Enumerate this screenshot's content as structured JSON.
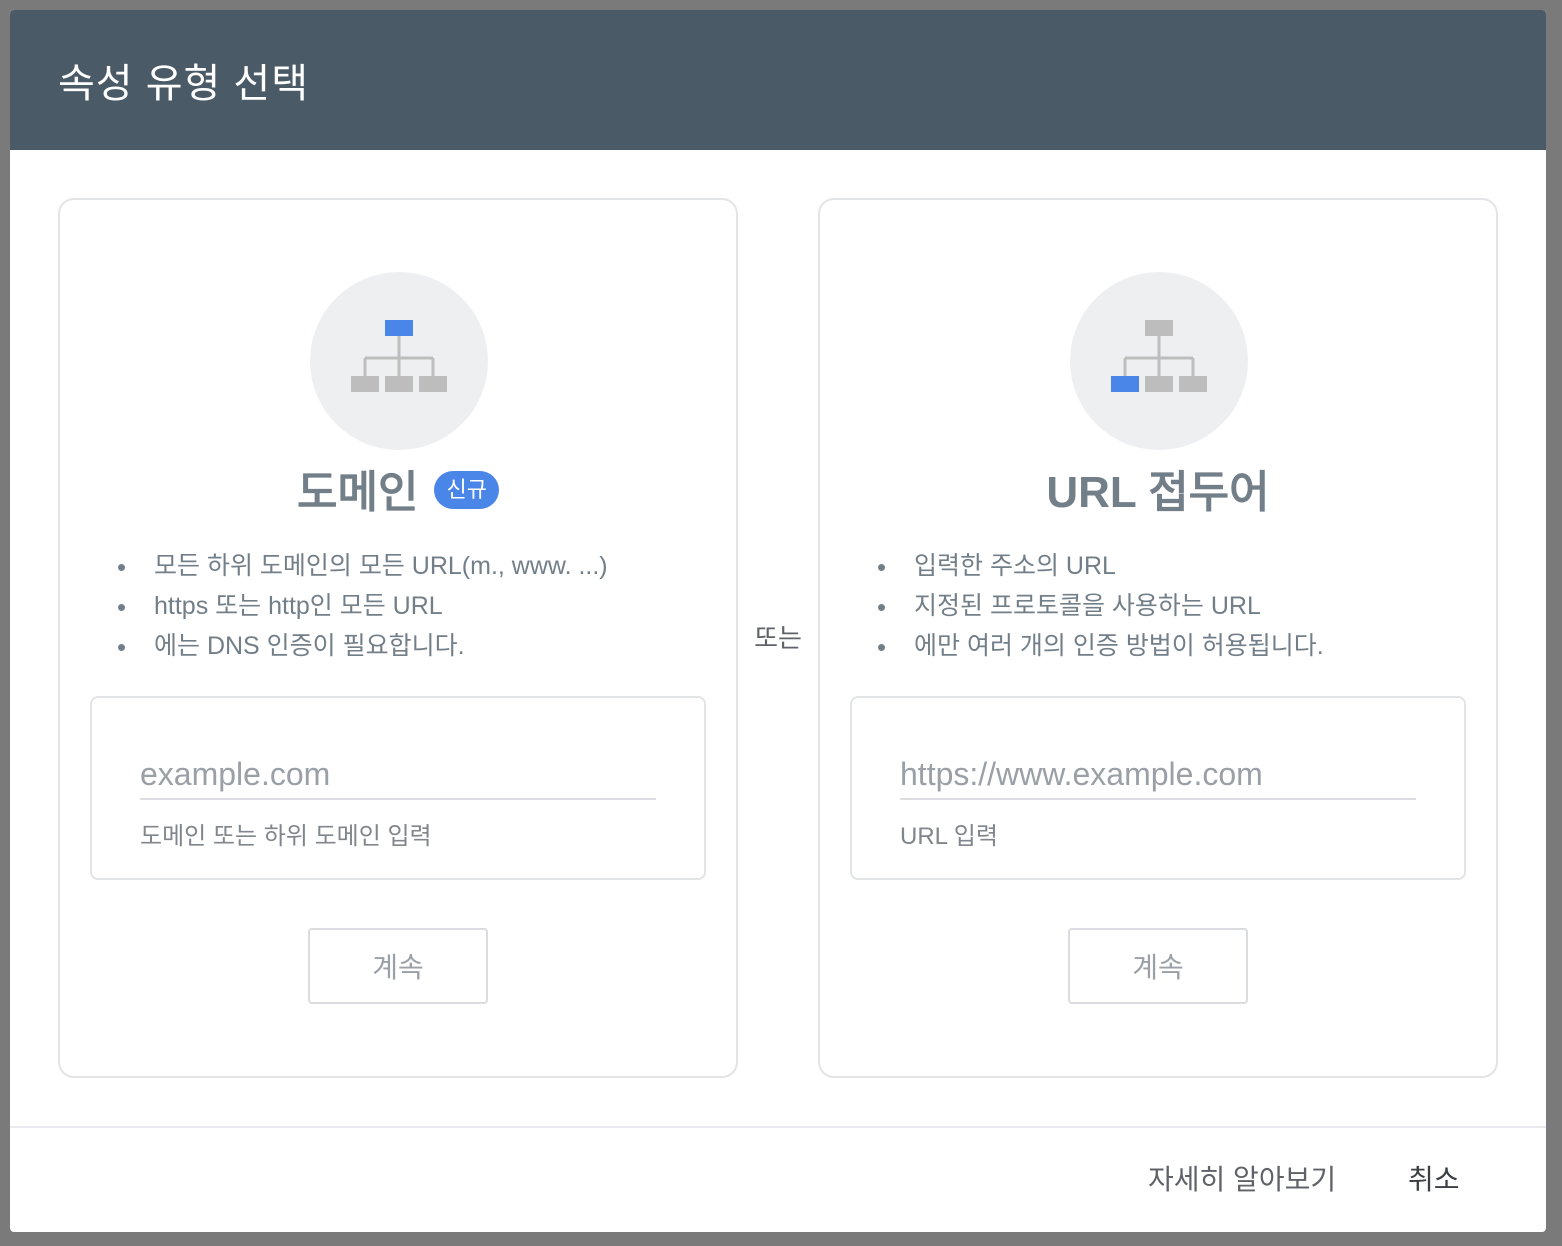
{
  "dialog": {
    "title": "속성 유형 선택",
    "or_label": "또는"
  },
  "domain_card": {
    "title": "도메인",
    "badge": "신규",
    "bullets": [
      "모든 하위 도메인의 모든 URL(m., www. ...)",
      "https 또는 http인 모든 URL",
      "에는 DNS 인증이 필요합니다."
    ],
    "input_placeholder": "example.com",
    "input_value": "",
    "helper_text": "도메인 또는 하위 도메인 입력",
    "continue_label": "계속",
    "icon": "sitemap-top-highlight-icon"
  },
  "url_prefix_card": {
    "title": "URL 접두어",
    "bullets": [
      "입력한 주소의 URL",
      "지정된 프로토콜을 사용하는 URL",
      "에만 여러 개의 인증 방법이 허용됩니다."
    ],
    "input_placeholder": "https://www.example.com",
    "input_value": "",
    "helper_text": "URL 입력",
    "continue_label": "계속",
    "icon": "sitemap-leaf-highlight-icon"
  },
  "footer": {
    "learn_more_label": "자세히 알아보기",
    "cancel_label": "취소"
  },
  "colors": {
    "header_bg": "#4a5a66",
    "accent_blue": "#4a86e8",
    "node_grey": "#bdbdbd",
    "text_grey": "#737f88"
  }
}
